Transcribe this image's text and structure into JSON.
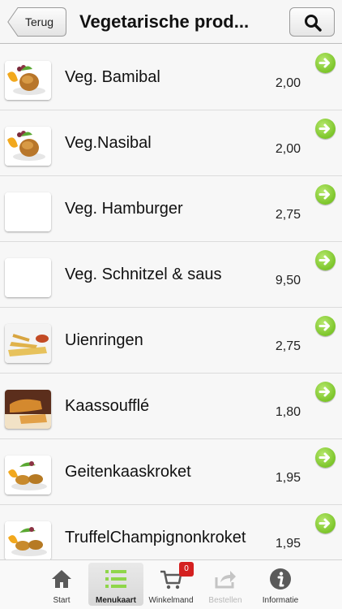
{
  "header": {
    "back_label": "Terug",
    "title": "Vegetarische prod..."
  },
  "products": [
    {
      "name": "Veg. Bamibal",
      "price": "2,00",
      "image": "bal-photo"
    },
    {
      "name": "Veg.Nasibal",
      "price": "2,00",
      "image": "bal-photo"
    },
    {
      "name": "Veg. Hamburger",
      "price": "2,75",
      "image": "placeholder"
    },
    {
      "name": "Veg. Schnitzel & saus",
      "price": "9,50",
      "image": "placeholder"
    },
    {
      "name": "Uienringen",
      "price": "2,75",
      "image": "uienringen-photo"
    },
    {
      "name": "Kaassoufflé",
      "price": "1,80",
      "image": "kaassouffle-photo"
    },
    {
      "name": "Geitenkaaskroket",
      "price": "1,95",
      "image": "kroket-photo"
    },
    {
      "name": "TruffelChampignonkroket",
      "price": "1,95",
      "image": "kroket-photo"
    }
  ],
  "tabbar": {
    "items": [
      {
        "label": "Start",
        "icon": "home-icon",
        "state": "normal"
      },
      {
        "label": "Menukaart",
        "icon": "list-icon",
        "state": "active"
      },
      {
        "label": "Winkelmand",
        "icon": "cart-icon",
        "state": "normal",
        "badge": "0"
      },
      {
        "label": "Bestellen",
        "icon": "share-icon",
        "state": "disabled"
      },
      {
        "label": "Informatie",
        "icon": "info-icon",
        "state": "normal"
      }
    ]
  },
  "colors": {
    "accent_green": "#7cc52a",
    "badge_red": "#d42020"
  }
}
